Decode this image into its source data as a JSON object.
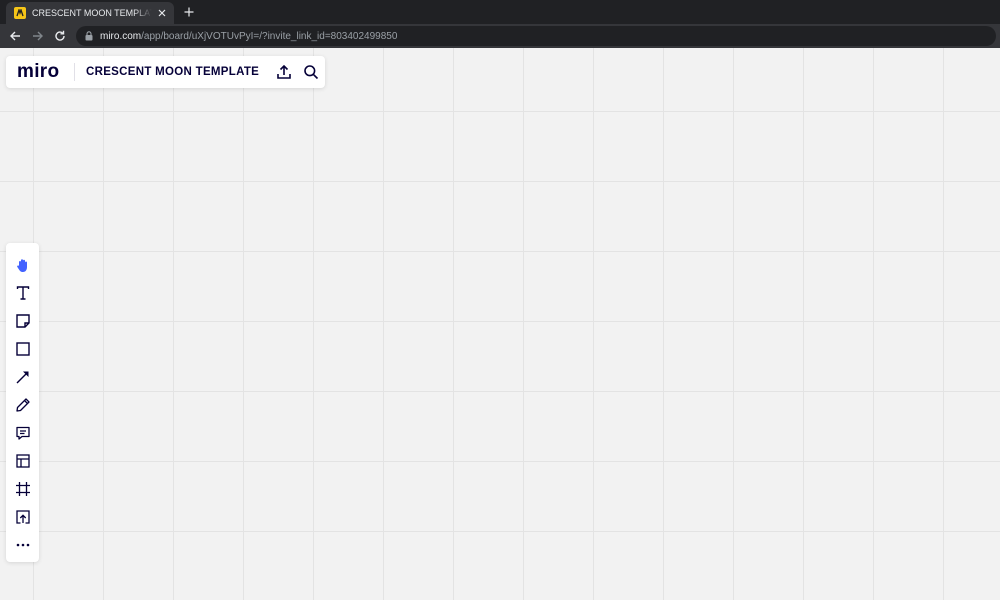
{
  "browser": {
    "tab_title": "CRESCENT MOON TEMPLATE, Online Whiteboard for Visual Collaboration",
    "url_host": "miro.com",
    "url_path": "/app/board/uXjVOTUvPyI=/?invite_link_id=803402499850"
  },
  "board": {
    "logo": "miro",
    "title": "CRESCENT MOON TEMPLATE"
  },
  "toolbar": {
    "tools": [
      "hand-tool",
      "text-tool",
      "sticky-note-tool",
      "shape-tool",
      "connection-line-tool",
      "pen-tool",
      "comment-tool",
      "frame-template-tool",
      "crop-frame-tool",
      "upload-tool",
      "more-tools"
    ],
    "active_tool": "hand-tool",
    "active_color": "#4262ff"
  },
  "colors": {
    "text_dark": "#050038",
    "canvas_bg": "#f2f2f2",
    "accent": "#4262ff"
  }
}
